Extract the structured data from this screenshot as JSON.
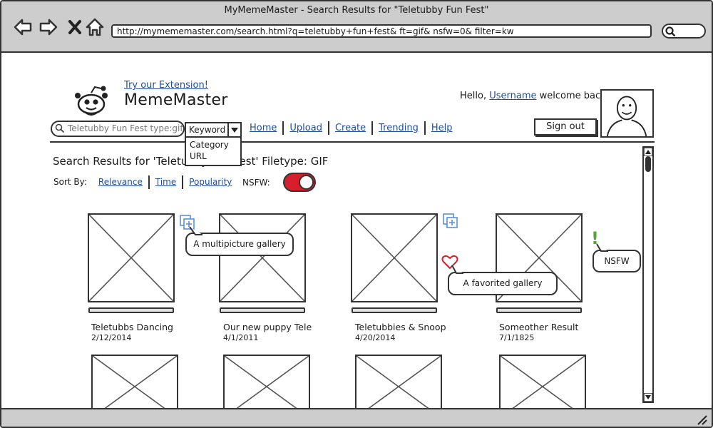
{
  "window": {
    "title": "MyMemeMaster - Search Results for \"Teletubby Fun Fest\"",
    "url": "http://mymememaster.com/search.html?q=teletubby+fun+fest& ft=gif& nsfw=0& filter=kw"
  },
  "header": {
    "extension_link": "Try our Extension!",
    "site_title": "MemeMaster",
    "greeting_prefix": "Hello,",
    "username": "Username",
    "greeting_suffix": "welcome back!",
    "signout_label": "Sign out"
  },
  "search": {
    "query": "Teletubby Fun Fest type:gif",
    "filter_selected": "Keyword",
    "filter_options": [
      "Category",
      "URL"
    ]
  },
  "nav": {
    "items": [
      "Home",
      "Upload",
      "Create",
      "Trending",
      "Help"
    ]
  },
  "results": {
    "heading": "Search Results for 'Teletubby Fun Fest' Filetype: GIF",
    "sort_label": "Sort By:",
    "sort_options": [
      "Relevance",
      "Time",
      "Popularity"
    ],
    "nsfw_label": "NSFW:",
    "nsfw_enabled": true,
    "items": [
      {
        "title": "Teletubbs Dancing",
        "date": "2/12/2014"
      },
      {
        "title": "Our new puppy Tele",
        "date": "4/1/2011"
      },
      {
        "title": "Teletubbies & Snoop",
        "date": "4/20/2014"
      },
      {
        "title": "Someother Result",
        "date": "7/1/1825"
      }
    ]
  },
  "annotations": {
    "multipicture": "A multipicture gallery",
    "favorited": "A favorited gallery",
    "nsfw": "NSFW",
    "nsfw_mark": "!"
  },
  "colors": {
    "link": "#1f4e96",
    "toggle_on": "#d61f2b",
    "gallery_icon": "#5b8fd6",
    "heart": "#d61f2b",
    "nsfw_mark": "#5aa63e",
    "chrome": "#cdcdcd"
  },
  "icons": {
    "back": "back-arrow-icon",
    "forward": "forward-arrow-icon",
    "stop": "close-icon",
    "home": "home-icon",
    "search": "search-icon",
    "gallery": "gallery-stack-icon",
    "favorite": "heart-icon"
  }
}
